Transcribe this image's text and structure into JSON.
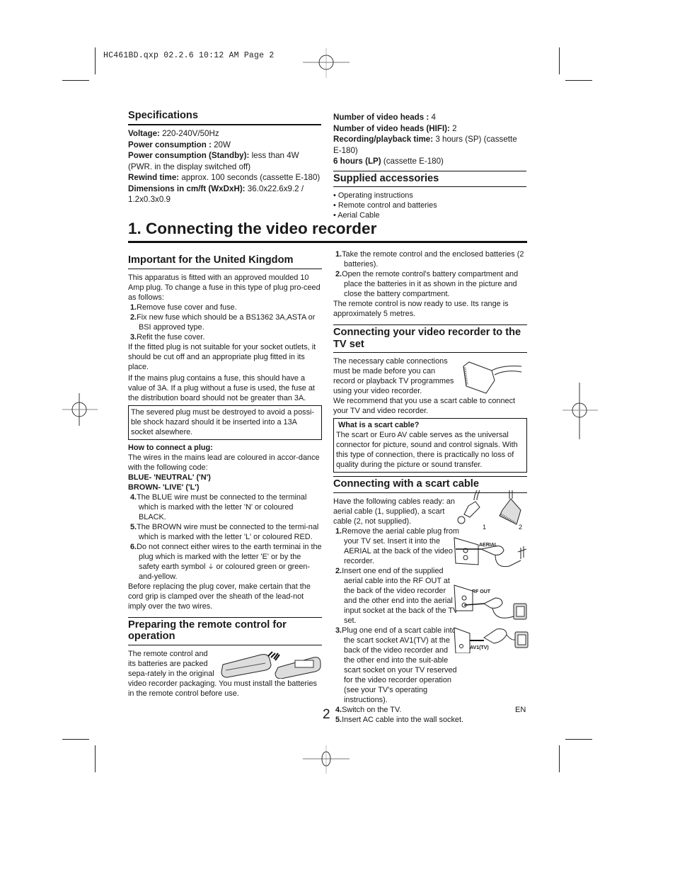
{
  "slug": "HC461BD.qxp  02.2.6  10:12 AM  Page 2",
  "specifications": {
    "title": "Specifications",
    "items": [
      {
        "label": "Voltage:",
        "value": " 220-240V/50Hz"
      },
      {
        "label": "Power consumption :",
        "value": " 20W"
      },
      {
        "label": "Power consumption (Standby):",
        "value": " less than 4W (PWR. in the display switched off)"
      },
      {
        "label": "Rewind time:",
        "value": " approx. 100 seconds (cassette E-180)"
      },
      {
        "label": "Dimensions in cm/ft (WxDxH):",
        "value": " 36.0x22.6x9.2 / 1.2x0.3x0.9"
      }
    ],
    "items_right": [
      {
        "label": "Number of video heads :",
        "value": " 4"
      },
      {
        "label": "Number of video heads (HIFI):",
        "value": " 2"
      },
      {
        "label": "Recording/playback time:",
        "value": " 3 hours (SP) (cassette E-180)"
      },
      {
        "label": "6 hours (LP)",
        "value": " (cassette E-180)"
      }
    ]
  },
  "accessories": {
    "title": "Supplied accessories",
    "items": [
      "• Operating instructions",
      "• Remote control and batteries",
      "• Aerial Cable"
    ]
  },
  "main_title": "1. Connecting the video recorder",
  "uk": {
    "title": "Important for the United Kingdom",
    "intro": "This apparatus is fitted with an approved moulded 10 Amp plug. To change a fuse in this type of plug pro-ceed as follows:",
    "steps": [
      {
        "n": "1.",
        "text": "Remove fuse cover and fuse."
      },
      {
        "n": "2.",
        "text": "Fix new fuse which should be a BS1362 3A,ASTA or BSI approved type."
      },
      {
        "n": "3.",
        "text": "Refit the fuse cover."
      }
    ],
    "para1": "If the fitted plug is not suitable for your socket outlets, it should be cut off and an appropriate plug fitted in its place.",
    "para2": "If the mains plug contains a fuse, this should have a value of 3A. If a plug without a fuse is used, the fuse at the distribution board should not be greater than 3A.",
    "warning": "The severed plug must be destroyed to avoid a possi-ble shock hazard should it be inserted into a 13A socket alsewhere.",
    "how_title": "How to connect a plug:",
    "how_text": "The wires in the mains lead are coloured in accor-dance with the following code:",
    "code1": "BLUE- 'NEUTRAL' ('N')",
    "code2": "BROWN- 'LIVE' ('L')",
    "steps2": [
      {
        "n": "4.",
        "text": "The BLUE wire must be connected to the terminal which is marked with the letter 'N' or coloured BLACK."
      },
      {
        "n": "5.",
        "text": "The BROWN wire must be connected to the termi-nal which is marked with the letter 'L' or coloured RED."
      },
      {
        "n": "6.",
        "text_a": "Do not connect either wires to the earth terminai in the plug which is marked with the letter 'E' or by the safety earth symbol",
        "symbol": "⏚",
        "text_b": " or coloured green or green-and-yellow."
      }
    ],
    "closing": "Before replacing the plug cover, make certain that the cord grip is clamped over the sheath of the lead-not imply over the two wires."
  },
  "remote": {
    "title": "Preparing the remote control for operation",
    "text": "The remote control and its batteries are packed sepa-rately in the original video recorder packaging. You must install the batteries in the remote control before use.",
    "steps": [
      {
        "n": "1.",
        "text": "Take the remote control and the enclosed batteries (2 batteries)."
      },
      {
        "n": "2.",
        "text": "Open the remote control's battery compartment and place the batteries in it as shown in the picture and close the battery compartment."
      }
    ],
    "range": "The remote control is now ready to use. Its range is approximately 5 metres."
  },
  "tvset": {
    "title": "Connecting your video recorder to the TV set",
    "text": "The necessary cable connections must be made before you can record or playback TV programmes using your video recorder.",
    "recommend": "We recommend that you use a scart cable to connect your TV and video recorder.",
    "box_title": "What is a scart cable?",
    "box_text": "The scart or Euro AV cable serves as the universal connector for picture, sound and control signals. With this type of connection, there is practically no loss of quality during the picture or sound transfer."
  },
  "scart": {
    "title": "Connecting with a scart cable",
    "intro": "Have the following cables ready: an aerial cable (1, supplied), a scart cable (2, not supplied).",
    "steps": [
      {
        "n": "1.",
        "text": "Remove the aerial cable plug from your TV set. Insert it into the AERIAL at the back of the video recorder."
      },
      {
        "n": "2.",
        "text": "Insert one end of the supplied aerial cable into the RF OUT at the back of the video recorder and the other end into the aerial input socket at the back of the TV set."
      },
      {
        "n": "3.",
        "text": "Plug one end of a scart cable into the scart socket AV1(TV)  at the back of the video recorder and the other end into the suit-able scart socket on your TV reserved for the video recorder operation (see your TV's operating instructions)."
      },
      {
        "n": "4.",
        "text": "Switch on the TV."
      },
      {
        "n": "5.",
        "text": "Insert AC cable into the wall socket."
      }
    ],
    "fig_labels": {
      "one": "1",
      "two": "2",
      "aerial": "AERIAL",
      "rfout": "RF OUT",
      "av1": "AV1(TV)"
    }
  },
  "page_number": "2",
  "lang": "EN"
}
